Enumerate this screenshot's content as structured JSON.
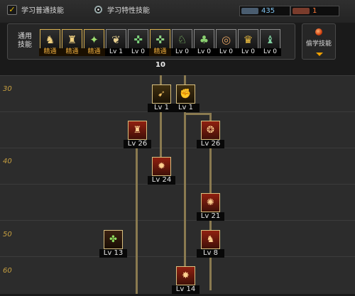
{
  "header": {
    "mode_normal": "学习普通技能",
    "mode_special": "学习特性技能",
    "sp_value": "435",
    "tp_value": "1"
  },
  "common": {
    "label": "通用\n技能",
    "skills": [
      {
        "icon": "sit-icon",
        "level": "精通",
        "learned": true
      },
      {
        "icon": "crouch-icon",
        "level": "精通",
        "learned": true
      },
      {
        "icon": "leap-icon",
        "level": "精通",
        "learned": true
      },
      {
        "icon": "wings-icon",
        "level": "Lv 1",
        "learned": false
      },
      {
        "icon": "crosshair-icon",
        "level": "Lv 0",
        "learned": false
      },
      {
        "icon": "crosshair-gold-icon",
        "level": "精通",
        "learned": true
      },
      {
        "icon": "mount-icon",
        "level": "Lv 0",
        "learned": false
      },
      {
        "icon": "creature-icon",
        "level": "Lv 0",
        "learned": false
      },
      {
        "icon": "target-ring-icon",
        "level": "Lv 0",
        "learned": false
      },
      {
        "icon": "golden-figure-icon",
        "level": "Lv 0",
        "learned": false
      },
      {
        "icon": "green-figure-icon",
        "level": "Lv 0",
        "learned": false
      }
    ],
    "steal_label": "偷学技能"
  },
  "tree_header": "10",
  "rows": [
    "30",
    "40",
    "50",
    "60"
  ],
  "tree_skills": [
    {
      "icon": "dash-icon",
      "level": "Lv 1",
      "style": "gold"
    },
    {
      "icon": "grab-icon",
      "level": "Lv 1",
      "style": "gold"
    },
    {
      "icon": "pillar-icon",
      "level": "Lv 26",
      "style": "red"
    },
    {
      "icon": "swirl-icon",
      "level": "Lv 26",
      "style": "red"
    },
    {
      "icon": "strike-icon",
      "level": "Lv 24",
      "style": "red"
    },
    {
      "icon": "fire-burst-icon",
      "level": "Lv 21",
      "style": "red"
    },
    {
      "icon": "poison-icon",
      "level": "Lv 13",
      "style": "green"
    },
    {
      "icon": "kick-icon",
      "level": "Lv 8",
      "style": "red"
    },
    {
      "icon": "explosion-icon",
      "level": "Lv 14",
      "style": "red"
    }
  ],
  "colors": {
    "accent": "#f0b040",
    "line": "#8a7a50",
    "sp": "#7fc3f0",
    "tp": "#ff7a3a"
  }
}
